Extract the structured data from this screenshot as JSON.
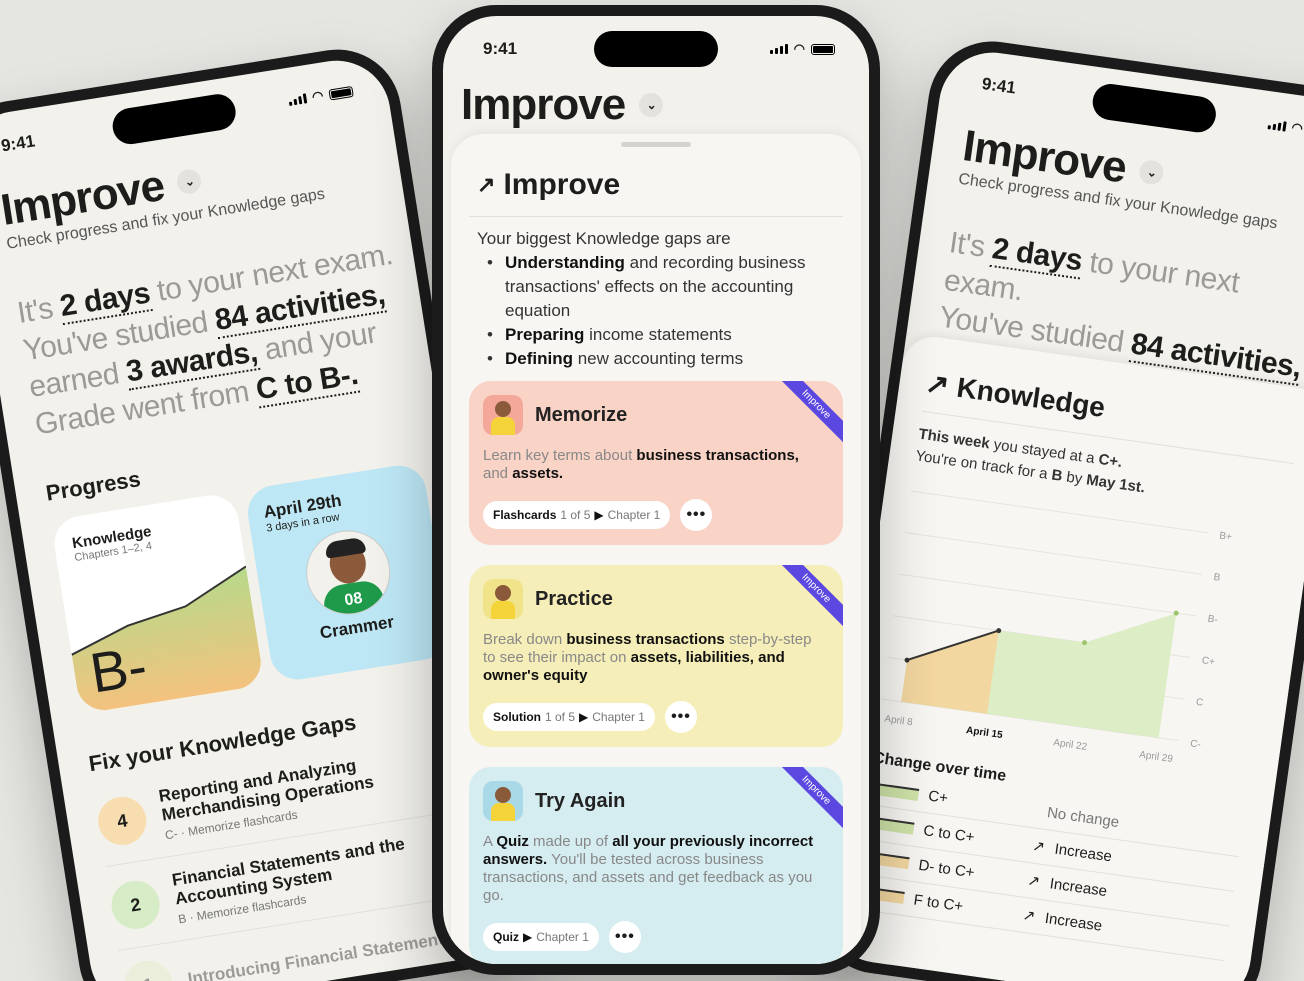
{
  "status_time": "9:41",
  "improve_title": "Improve",
  "subtitle": "Check progress and fix your Knowledge gaps",
  "hero": {
    "part1": "It's ",
    "days": "2 days",
    "part2": " to your next exam.",
    "part3": "You've studied ",
    "activities": "84 activities,",
    "part4": "earned ",
    "awards": "3 awards,",
    "part5": " and your",
    "part6": "Grade went from ",
    "grade": "C to B-."
  },
  "progress": {
    "heading": "Progress",
    "knowledge_tile": {
      "title": "Knowledge",
      "chapters": "Chapters 1–2, 4",
      "grade": "B-"
    },
    "streak_tile": {
      "date": "April 29th",
      "streak": "3 days in a row",
      "jersey": "08",
      "name": "Crammer"
    }
  },
  "fix_gaps": {
    "heading": "Fix your Knowledge Gaps",
    "items": [
      {
        "num": "4",
        "title": "Reporting and Analyzing Merchandising Operations",
        "grade": "C-",
        "action": "Memorize flashcards",
        "color": "#f8ddb0"
      },
      {
        "num": "2",
        "title": "Financial Statements and the Accounting System",
        "grade": "B",
        "action": "Memorize flashcards",
        "color": "#d6ecc6"
      },
      {
        "num": "1",
        "title": "Introducing Financial Statements",
        "grade": "",
        "action": "",
        "color": "#e2ecc0"
      }
    ]
  },
  "sheet": {
    "title": "Improve",
    "intro": "Your biggest Knowledge gaps are",
    "gaps": [
      {
        "bold": "Understanding",
        "rest": " and recording business transactions' effects on the accounting equation"
      },
      {
        "bold": "Preparing",
        "rest": " income statements"
      },
      {
        "bold": "Defining",
        "rest": " new accounting terms"
      }
    ]
  },
  "cards": [
    {
      "title": "Memorize",
      "ribbon": "Improve",
      "desc_pre": "Learn key terms about ",
      "desc_b1": "business transactions,",
      "desc_mid": " and ",
      "desc_b2": "assets.",
      "desc_post": "",
      "pill_type": "Flashcards",
      "pill_count": "1 of 5",
      "pill_chapter": "Chapter 1",
      "more": "•••",
      "bg": "#f9d3c6"
    },
    {
      "title": "Practice",
      "ribbon": "Improve",
      "desc_pre": "Break down ",
      "desc_b1": "business transactions",
      "desc_mid": " step-by-step to see their impact on ",
      "desc_b2": "assets, liabilities, and owner's equity",
      "desc_post": "",
      "pill_type": "Solution",
      "pill_count": "1 of 5",
      "pill_chapter": "Chapter 1",
      "more": "•••",
      "bg": "#f6eeb8"
    },
    {
      "title": "Try Again",
      "ribbon": "Improve",
      "desc_pre": "A ",
      "desc_b1": "Quiz",
      "desc_mid": " made up of ",
      "desc_b2": "all your previously incorrect answers.",
      "desc_post": " You'll be tested across business transactions, and assets and get feedback as you go.",
      "pill_type": "Quiz",
      "pill_count": "",
      "pill_chapter": "Chapter 1",
      "more": "•••",
      "bg": "#d5ecf0"
    }
  ],
  "knowledge_panel": {
    "title": "Knowledge",
    "line1_pre": "This week",
    "line1_post": " you stayed at a ",
    "line1_grade": "C+.",
    "line2_pre": "You're on track for a ",
    "line2_b": "B",
    "line2_mid": " by ",
    "line2_date": "May 1st."
  },
  "chart_data": {
    "type": "area",
    "x": [
      "April 8",
      "April 15",
      "April 22",
      "April 29"
    ],
    "y_ticks": [
      "B+",
      "B",
      "B-",
      "C+",
      "C",
      "C-"
    ],
    "series": [
      {
        "values": [
          "C",
          "C+",
          "C+",
          "B-"
        ]
      }
    ]
  },
  "over_time": {
    "heading": "Change over time",
    "rows": [
      {
        "label": "C+",
        "change": "No change",
        "arrow": ""
      },
      {
        "label": "C to C+",
        "change": "Increase",
        "arrow": "↗"
      },
      {
        "label": "D- to C+",
        "change": "Increase",
        "arrow": "↗"
      },
      {
        "label": "F to C+",
        "change": "Increase",
        "arrow": "↗"
      }
    ]
  },
  "colors": {
    "accent": "#5b48e0",
    "grade_green": "#b7d98a",
    "grade_orange": "#f3c27e",
    "streak_blue": "#bde7f5"
  }
}
